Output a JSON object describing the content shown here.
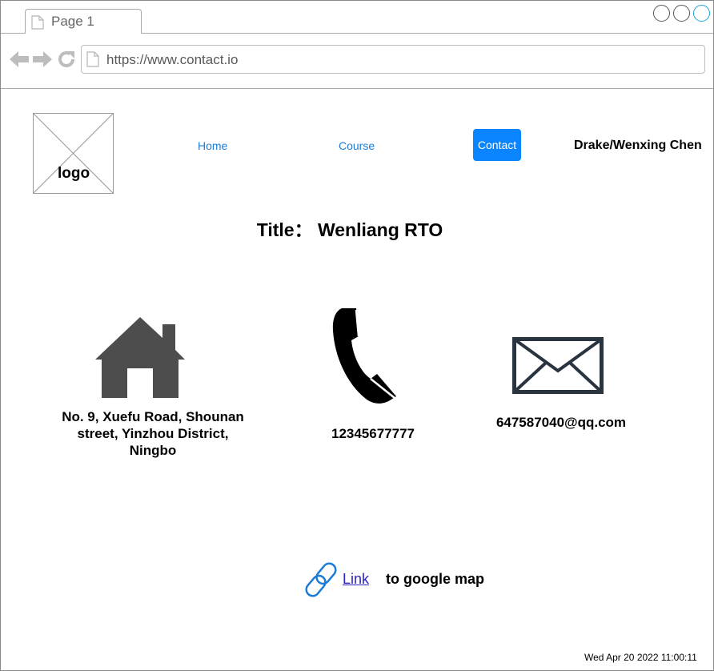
{
  "browser": {
    "tab_title": "Page 1",
    "url": "https://www.contact.io"
  },
  "header": {
    "logo_label": "logo",
    "nav": {
      "home": "Home",
      "course": "Course",
      "contact": "Contact"
    },
    "user_name": "Drake/Wenxing Chen"
  },
  "main": {
    "title": "Title：  Wenliang RTO",
    "address_lines": [
      "No. 9, Xuefu Road, Shounan",
      "street, Yinzhou District,",
      "Ningbo"
    ],
    "phone": "12345677777",
    "email": "647587040@qq.com",
    "map_link_label": "Link",
    "map_link_suffix": "to google map"
  },
  "footer": {
    "timestamp": "Wed Apr 20 2022 11:00:11"
  },
  "colors": {
    "accent": "#0a84ff",
    "link": "#1c7cd6",
    "icon_dark": "#4d4d4d"
  }
}
